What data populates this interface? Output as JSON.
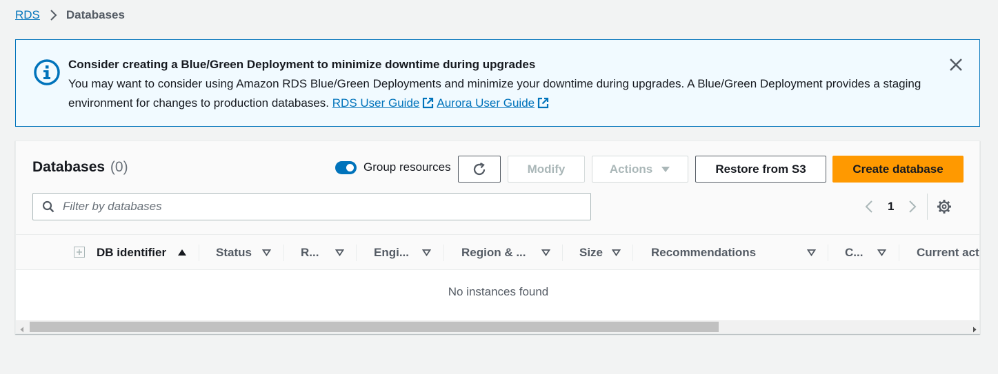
{
  "breadcrumb": {
    "root": "RDS",
    "current": "Databases"
  },
  "banner": {
    "title": "Consider creating a Blue/Green Deployment to minimize downtime during upgrades",
    "body": "You may want to consider using Amazon RDS Blue/Green Deployments and minimize your downtime during upgrades. A Blue/Green Deployment provides a staging environment for changes to production databases.",
    "link1": "RDS User Guide",
    "link2": "Aurora User Guide",
    "icon": "info-icon",
    "close_icon": "close-icon"
  },
  "panel": {
    "title": "Databases",
    "count": "(0)",
    "group_toggle_label": "Group resources",
    "group_toggle_on": true,
    "modify_label": "Modify",
    "actions_label": "Actions",
    "restore_label": "Restore from S3",
    "create_label": "Create database",
    "filter_placeholder": "Filter by databases",
    "page": "1"
  },
  "table": {
    "columns": [
      {
        "label": "DB identifier",
        "sorted": "ascending"
      },
      {
        "label": "Status"
      },
      {
        "label": "R..."
      },
      {
        "label": "Engi..."
      },
      {
        "label": "Region & ..."
      },
      {
        "label": "Size"
      },
      {
        "label": "Recommendations"
      },
      {
        "label": "C..."
      },
      {
        "label": "Current act"
      }
    ],
    "empty_message": "No instances found"
  },
  "colors": {
    "link": "#0073bb",
    "primary_button": "#ff9900",
    "banner_bg": "#f1faff",
    "toggle_on": "#0073bb"
  }
}
